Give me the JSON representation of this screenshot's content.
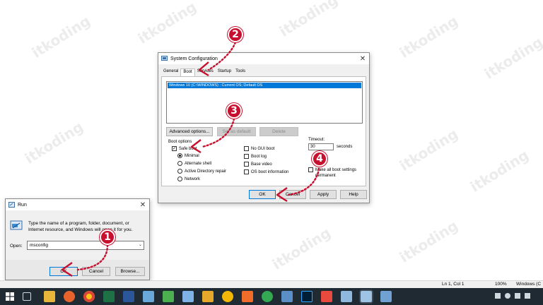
{
  "watermark": "itkoding",
  "colors": {
    "accent": "#c8102e",
    "taskbar": "#1f2a33",
    "selection": "#0078d7"
  },
  "msconfig": {
    "title": "System Configuration",
    "close": "✕",
    "tabs": [
      "General",
      "Boot",
      "Services",
      "Startup",
      "Tools"
    ],
    "os_entry": "Windows 10 (C:\\WINDOWS) : Current OS; Default OS",
    "buttons": {
      "advanced": "Advanced options...",
      "set_default": "Set as default",
      "delete": "Delete",
      "ok": "OK",
      "cancel": "Cancel",
      "apply": "Apply",
      "help": "Help"
    },
    "boot_options_label": "Boot options",
    "safe_boot": "Safe boot",
    "minimal": "Minimal",
    "alternate_shell": "Alternate shell",
    "ad_repair": "Active Directory repair",
    "network": "Network",
    "no_gui": "No GUI boot",
    "boot_log": "Boot log",
    "base_video": "Base video",
    "os_boot_info": "OS boot information",
    "timeout_label": "Timeout:",
    "timeout_value": "30",
    "seconds": "seconds",
    "permanent_line1": "Make all boot settings",
    "permanent_line2": "permanent"
  },
  "run": {
    "title": "Run",
    "close": "✕",
    "description": "Type the name of a program, folder, document, or Internet resource, and Windows will open it for you.",
    "open_label": "Open:",
    "open_value": "msconfig",
    "buttons": {
      "ok": "OK",
      "cancel": "Cancel",
      "browse": "Browse..."
    }
  },
  "statusbar": {
    "position": "Ln 1, Col 1",
    "zoom": "100%",
    "eol": "Windows (C"
  },
  "markers": [
    "1",
    "2",
    "3",
    "4"
  ]
}
